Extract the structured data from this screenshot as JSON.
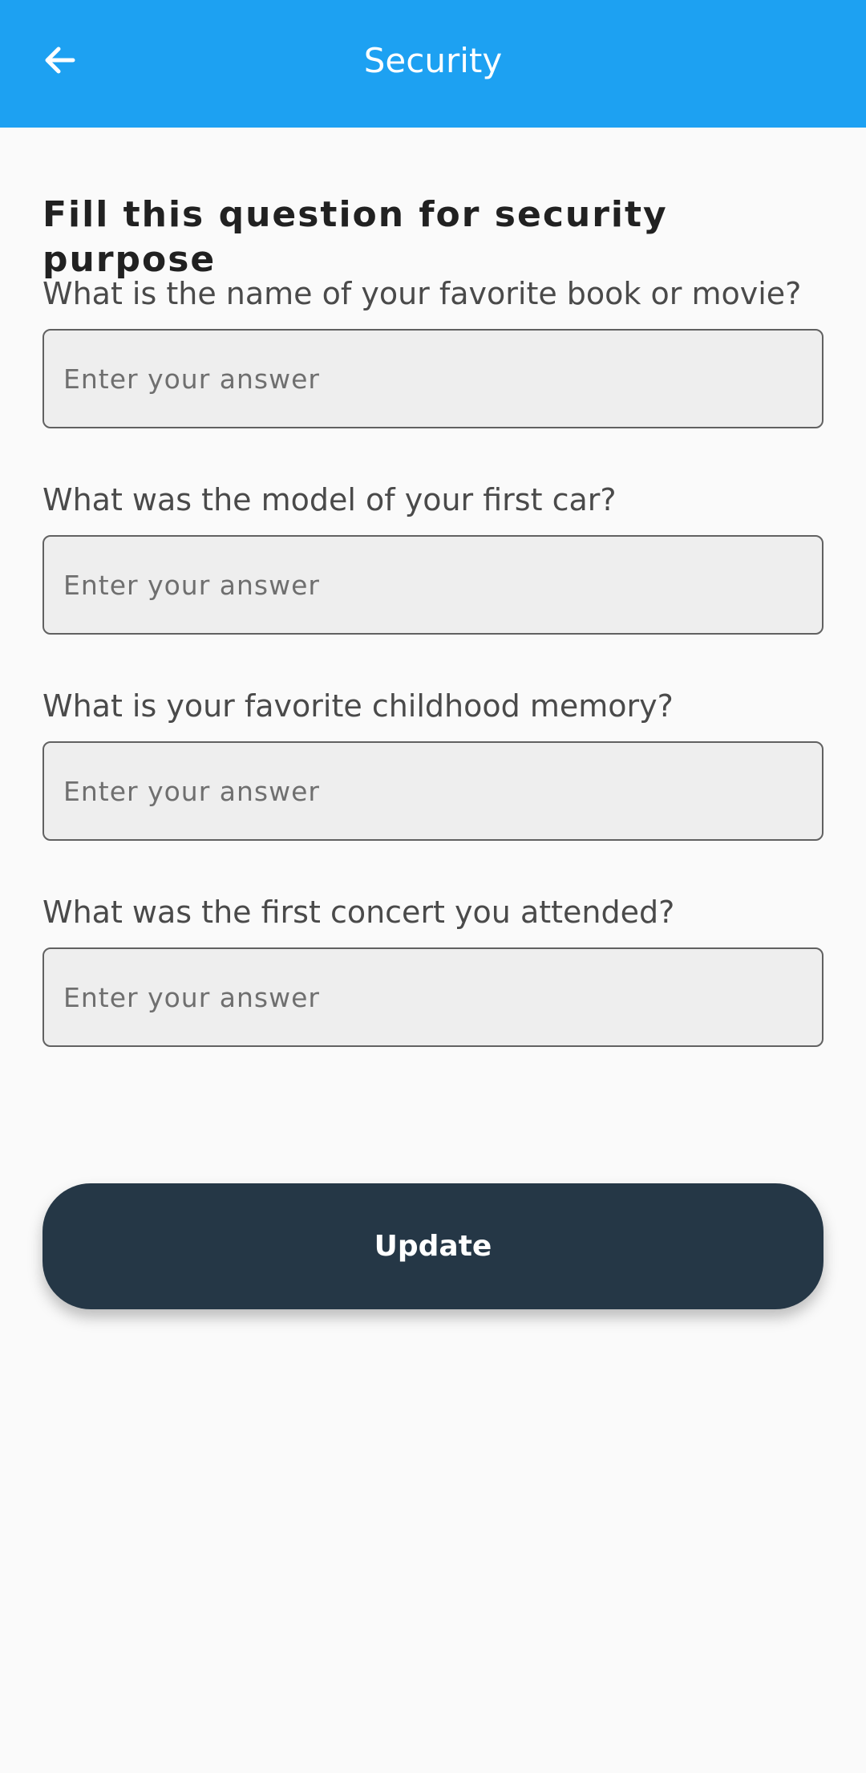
{
  "app_bar": {
    "title": "Security",
    "back_icon": "arrow-left-icon",
    "background_color": "#1da1f2"
  },
  "form": {
    "heading": "Fill this question for security purpose",
    "questions": [
      {
        "label": "What is the name of your favorite book or movie?",
        "placeholder": "Enter your answer",
        "value": ""
      },
      {
        "label": "What was the model of your first car?",
        "placeholder": "Enter your answer",
        "value": ""
      },
      {
        "label": "What is your favorite childhood memory?",
        "placeholder": "Enter your answer",
        "value": ""
      },
      {
        "label": "What was the first concert you attended?",
        "placeholder": "Enter your answer",
        "value": ""
      }
    ],
    "submit_label": "Update",
    "submit_color": "#253746"
  }
}
